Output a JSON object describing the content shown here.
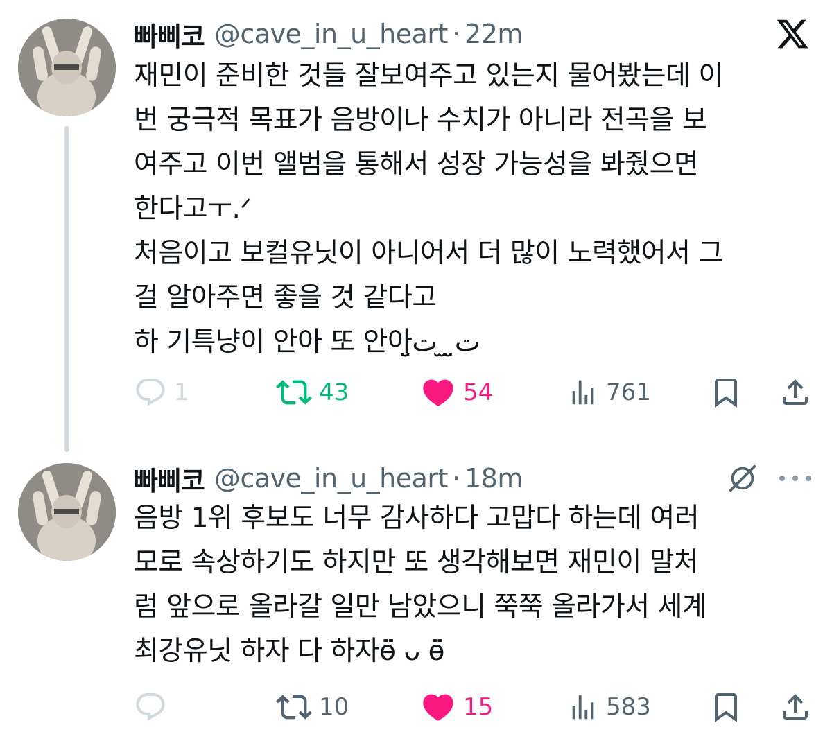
{
  "tweets": [
    {
      "display_name": "빠삐코",
      "handle": "@cave_in_u_heart",
      "separator": "·",
      "time": "22m",
      "body_lines": [
        "재민이 준비한 것들 잘보여주고 있는지 물어봤는데 이",
        "번 궁극적 목표가 음방이나 수치가 아니라 전곡을 보",
        "여주고 이번 앨범을 통해서 성장 가능성을 봐줬으면",
        "한다고ㅜ.ᐟ",
        "처음이고 보컬유닛이 아니어서 더 많이 노력했어서 그",
        "걸 알아주면 좋을 것 같다고",
        "하 기특냥이 안아 또 안아ت̤̮ ̫ ت̤̮"
      ],
      "stats": {
        "replies": "1",
        "reposts": "43",
        "likes": "54",
        "views": "761"
      },
      "icons": {
        "reply": "reply-icon",
        "repost": "repost-icon",
        "like": "heart-icon",
        "views": "views-icon",
        "bookmark": "bookmark-icon",
        "share": "share-icon",
        "brand": "x-logo-icon"
      }
    },
    {
      "display_name": "빠삐코",
      "handle": "@cave_in_u_heart",
      "separator": "·",
      "time": "18m",
      "body_lines": [
        "음방 1위 후보도 너무 감사하다 고맙다 하는데 여러",
        "모로 속상하기도 하지만 또 생각해보면 재민이 말처",
        "럼 앞으로 올라갈 일만 남았으니 쭉쭉 올라가서 세계",
        "최강유닛 하자 다 하자ӫ̈ ᴗ ӫ̈"
      ],
      "stats": {
        "replies": "",
        "reposts": "10",
        "likes": "15",
        "views": "583"
      },
      "icons": {
        "reply": "reply-icon",
        "repost": "repost-icon",
        "like": "heart-icon",
        "views": "views-icon",
        "bookmark": "bookmark-icon",
        "share": "share-icon",
        "grok": "grok-icon",
        "more": "more-icon"
      }
    }
  ],
  "colors": {
    "text_primary": "#0f1419",
    "text_secondary": "#536471",
    "repost_active": "#00ba7c",
    "like_active": "#f91880",
    "thread_line": "#cfd9de",
    "reply_muted": "#cfd9de"
  }
}
